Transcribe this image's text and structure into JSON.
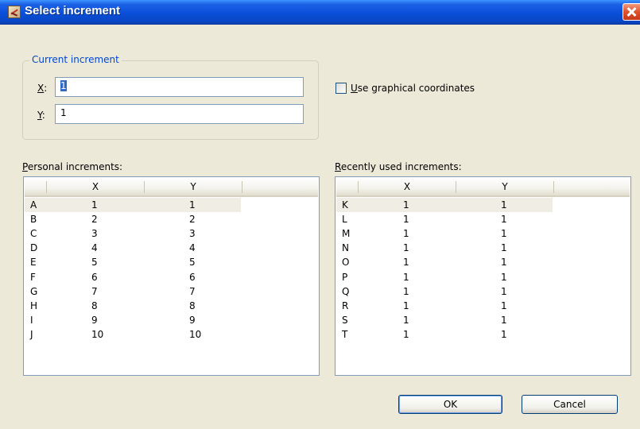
{
  "window": {
    "title": "Select increment",
    "icon": "app-icon",
    "close_icon": "close-icon"
  },
  "current_increment": {
    "group_title": "Current increment",
    "x_label_key": "X",
    "x_label_rest": ":",
    "x_value": "1",
    "y_label_key": "Y",
    "y_label_rest": ":",
    "y_value": "1"
  },
  "graphical": {
    "label_key": "U",
    "label_rest": "se graphical coordinates",
    "checked": false
  },
  "personal": {
    "label_key": "P",
    "label_rest": "ersonal increments:",
    "columns": [
      "",
      "X",
      "Y"
    ],
    "rows": [
      [
        "A",
        "1",
        "1"
      ],
      [
        "B",
        "2",
        "2"
      ],
      [
        "C",
        "3",
        "3"
      ],
      [
        "D",
        "4",
        "4"
      ],
      [
        "E",
        "5",
        "5"
      ],
      [
        "F",
        "6",
        "6"
      ],
      [
        "G",
        "7",
        "7"
      ],
      [
        "H",
        "8",
        "8"
      ],
      [
        "I",
        "9",
        "9"
      ],
      [
        "J",
        "10",
        "10"
      ]
    ]
  },
  "recent": {
    "label_key": "R",
    "label_rest": "ecently used increments:",
    "columns": [
      "",
      "X",
      "Y"
    ],
    "rows": [
      [
        "K",
        "1",
        "1"
      ],
      [
        "L",
        "1",
        "1"
      ],
      [
        "M",
        "1",
        "1"
      ],
      [
        "N",
        "1",
        "1"
      ],
      [
        "O",
        "1",
        "1"
      ],
      [
        "P",
        "1",
        "1"
      ],
      [
        "Q",
        "1",
        "1"
      ],
      [
        "R",
        "1",
        "1"
      ],
      [
        "S",
        "1",
        "1"
      ],
      [
        "T",
        "1",
        "1"
      ]
    ]
  },
  "buttons": {
    "ok": "OK",
    "cancel": "Cancel"
  }
}
